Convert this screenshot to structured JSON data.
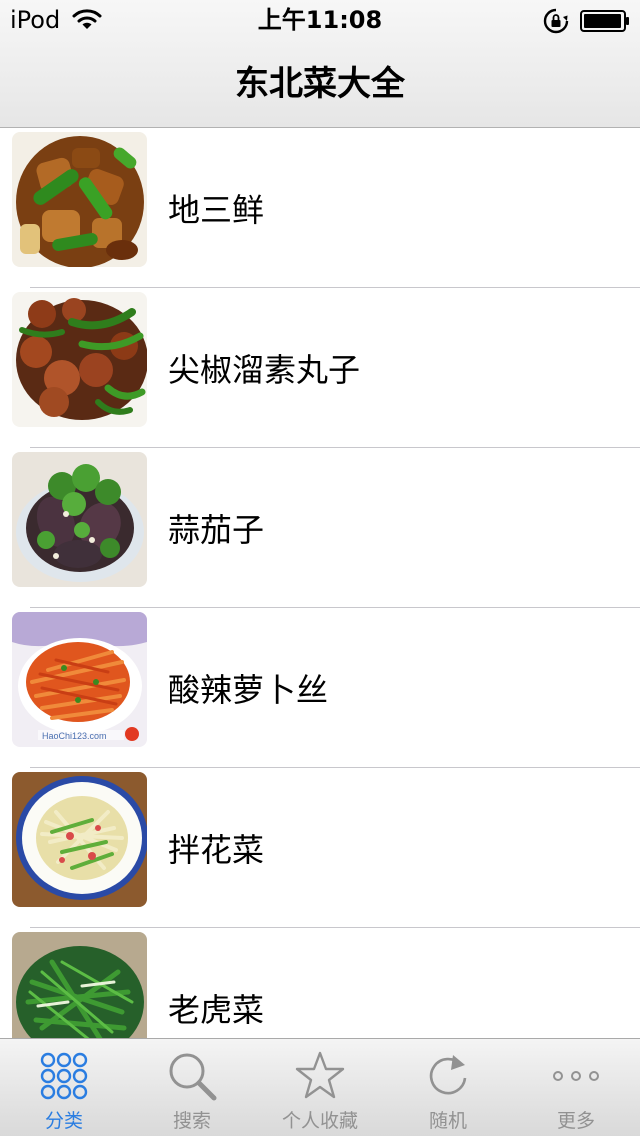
{
  "status_bar": {
    "carrier": "iPod",
    "time": "上午11:08",
    "wifi_icon": "wifi-icon",
    "lock_icon": "rotation-lock-icon",
    "battery_icon": "battery-icon"
  },
  "nav": {
    "title": "东北菜大全"
  },
  "list": {
    "items": [
      {
        "label": "地三鲜",
        "icon": "dish-photo"
      },
      {
        "label": "尖椒溜素丸子",
        "icon": "dish-photo"
      },
      {
        "label": "蒜茄子",
        "icon": "dish-photo"
      },
      {
        "label": "酸辣萝卜丝",
        "icon": "dish-photo"
      },
      {
        "label": "拌花菜",
        "icon": "dish-photo"
      },
      {
        "label": "老虎菜",
        "icon": "dish-photo"
      }
    ]
  },
  "tabbar": {
    "active_color": "#2a7de1",
    "inactive_color": "#929292",
    "tabs": [
      {
        "label": "分类",
        "icon": "grid-dots-icon",
        "active": true
      },
      {
        "label": "搜索",
        "icon": "search-icon",
        "active": false
      },
      {
        "label": "个人收藏",
        "icon": "star-icon",
        "active": false
      },
      {
        "label": "随机",
        "icon": "refresh-icon",
        "active": false
      },
      {
        "label": "更多",
        "icon": "more-dots-icon",
        "active": false
      }
    ]
  }
}
